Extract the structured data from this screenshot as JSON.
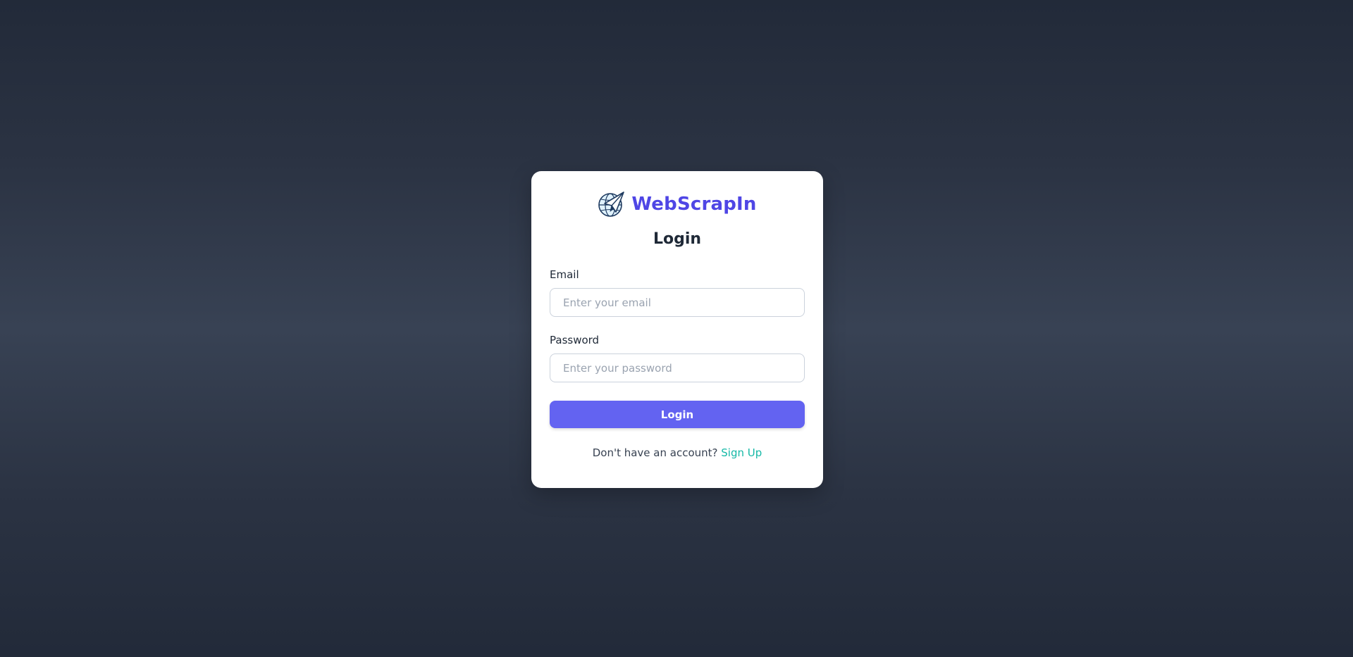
{
  "brand": {
    "name": "WebScrapIn",
    "logo_icon": "globe-paper-plane-icon",
    "color": "#4f46e5"
  },
  "login_form": {
    "title": "Login",
    "email_label": "Email",
    "email_placeholder": "Enter your email",
    "email_value": "",
    "password_label": "Password",
    "password_placeholder": "Enter your password",
    "password_value": "",
    "submit_label": "Login",
    "submit_color": "#6363f1"
  },
  "signup": {
    "prompt": "Don't have an account?",
    "link_label": "Sign Up",
    "link_color": "#14b8a6"
  }
}
